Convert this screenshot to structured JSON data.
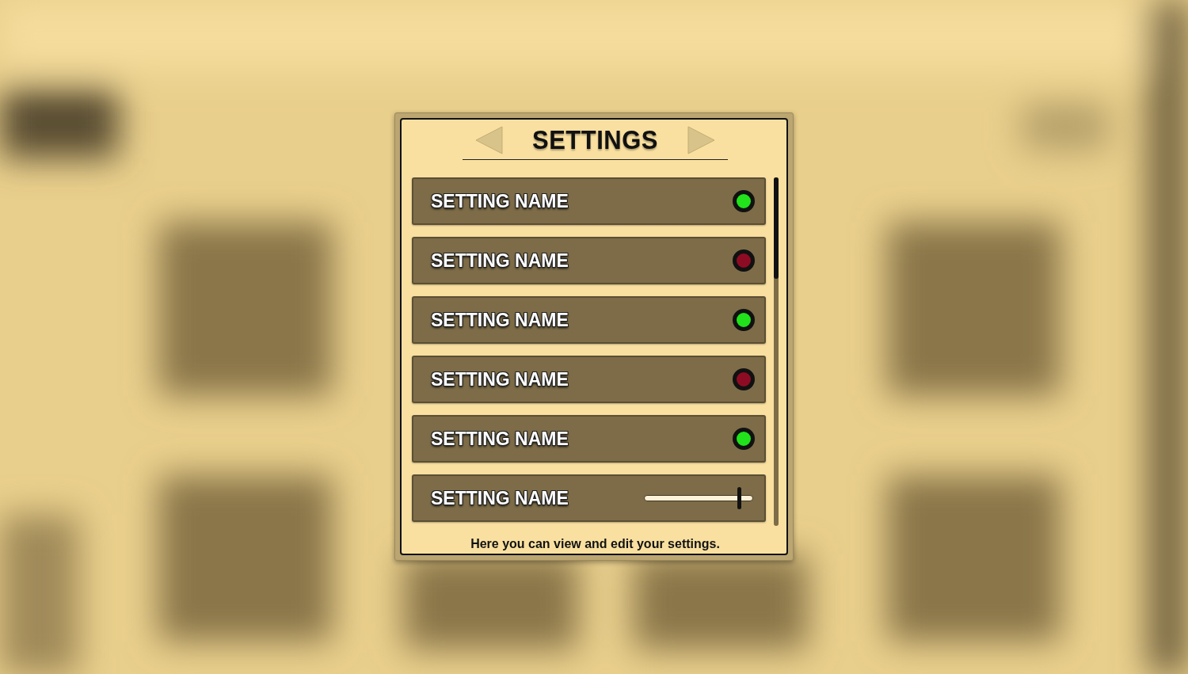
{
  "title": "SETTINGS",
  "settings": [
    {
      "kind": "toggle",
      "name": "SETTING NAME",
      "on": true
    },
    {
      "kind": "toggle",
      "name": "SETTING NAME",
      "on": false
    },
    {
      "kind": "toggle",
      "name": "SETTING NAME",
      "on": true
    },
    {
      "kind": "toggle",
      "name": "SETTING NAME",
      "on": false
    },
    {
      "kind": "toggle",
      "name": "SETTING NAME",
      "on": true
    },
    {
      "kind": "slider",
      "name": "SETTING NAME",
      "level": 0.86
    }
  ],
  "footer": "Here you can view and edit your settings."
}
